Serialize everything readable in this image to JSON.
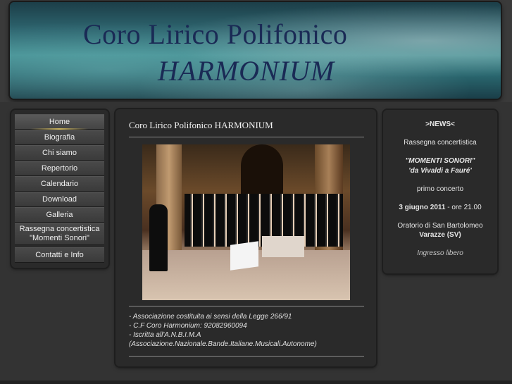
{
  "header": {
    "title": "Coro Lirico Polifonico",
    "subtitle": "HARMONIUM"
  },
  "nav": {
    "items": [
      {
        "label": "Home"
      },
      {
        "label": "Biografia"
      },
      {
        "label": "Chi siamo"
      },
      {
        "label": "Repertorio"
      },
      {
        "label": "Calendario"
      },
      {
        "label": "Download"
      },
      {
        "label": "Galleria"
      },
      {
        "label": "Rassegna concertistica",
        "label2": "\"Momenti Sonori\""
      },
      {
        "label": "Contatti e Info"
      }
    ]
  },
  "main": {
    "title": "Coro Lirico Polifonico HARMONIUM",
    "info": [
      "- Associazione costituita ai sensi della Legge 266/91",
      "- C.F Coro Harmonium:  92082960094",
      "- Iscritta all'A.N.B.I.M.A",
      "(Associazione.Nazionale.Bande.Italiane.Musicali.Autonome)"
    ]
  },
  "news": {
    "heading": ">NEWS<",
    "line1": "Rassegna concertistica",
    "event_name": "\"MOMENTI SONORI\"",
    "event_sub": "'da Vivaldi a Fauré'",
    "line2": "primo concerto",
    "date": "3 giugno 2011",
    "time": " - ore 21.00",
    "venue": "Oratorio di San Bartolomeo",
    "city": "Varazze (SV)",
    "entry": "Ingresso libero"
  }
}
